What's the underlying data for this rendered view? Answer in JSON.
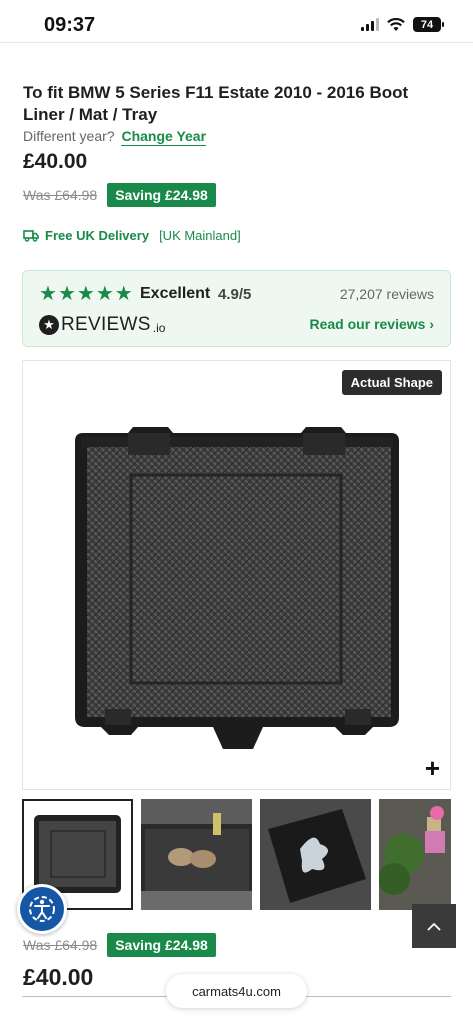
{
  "status_bar": {
    "time": "09:37",
    "battery": "74",
    "icons": [
      "signal-icon",
      "wifi-icon",
      "battery-icon"
    ]
  },
  "product": {
    "title": "To fit BMW 5 Series F11 Estate 2010 - 2016 Boot Liner / Mat / Tray",
    "different_year_label": "Different year?",
    "change_year_link": "Change Year",
    "price": "£40.00",
    "was_price": "Was £64.98",
    "saving": "Saving £24.98"
  },
  "delivery": {
    "icon": "truck-icon",
    "label": "Free UK Delivery",
    "note": "[UK Mainland]"
  },
  "reviews": {
    "stars": 5,
    "rating_word": "Excellent",
    "rating_value": "4.9/5",
    "review_count": "27,207 reviews",
    "logo_text": "REVIEWS",
    "logo_suffix": ".io",
    "read_link": "Read our reviews ›"
  },
  "gallery": {
    "badge": "Actual Shape",
    "zoom_icon": "+",
    "thumbnails": [
      "boot-liner-thumb",
      "boot-with-shoes-thumb",
      "liner-with-water-thumb",
      "plants-thumb"
    ]
  },
  "sticky_bar": {
    "was_price": "Was £64.98",
    "saving": "Saving £24.98",
    "price": "£40.00"
  },
  "browser": {
    "url": "carmats4u.com"
  },
  "colors": {
    "brand_green": "#1a8a4a",
    "review_card_bg": "#eef8f1",
    "accessibility_blue": "#1557a6"
  }
}
